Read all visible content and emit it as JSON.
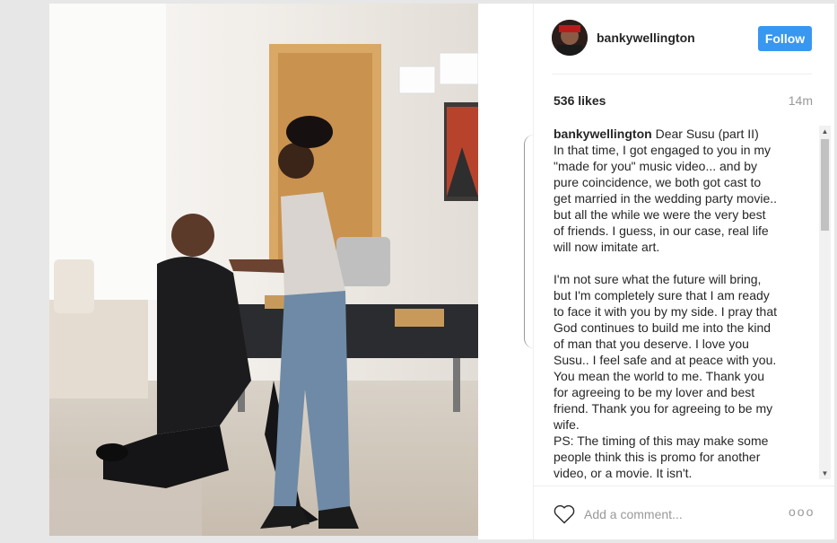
{
  "post": {
    "username": "bankywellington",
    "follow_label": "Follow",
    "likes": "536 likes",
    "time": "14m",
    "caption_user": "bankywellington",
    "caption_lines": [
      "Dear Susu (part II)",
      "In that time, I got engaged to you in my",
      "\"made for you\" music video... and by",
      "pure coincidence, we both got cast to",
      "get married in the wedding party movie..",
      "but all the while we were the very best",
      "of friends. I guess, in our case, real life",
      "will now imitate art.",
      "",
      "I'm not sure what the future will bring,",
      "but I'm completely sure that I am ready",
      "to face it with you by my side. I pray that",
      "God continues to build me into the kind",
      "of man that you deserve. I love you",
      "Susu.. I feel safe and at peace with you.",
      "You mean the world to me. Thank you",
      "for agreeing to be my lover and best",
      "friend. Thank you for agreeing to be my",
      "wife.",
      "PS: The timing of this may make some",
      "people think this is promo for another",
      "video, or a movie. It isn't."
    ],
    "comment_placeholder": "Add a comment...",
    "more_label": "ooo"
  },
  "icons": {
    "like": "heart-icon",
    "more": "more-options-icon",
    "scroll_up": "scroll-up-arrow-icon",
    "scroll_down": "scroll-down-arrow-icon"
  },
  "colors": {
    "follow_button": "#3897f0",
    "text": "#262626",
    "muted": "#999999"
  }
}
